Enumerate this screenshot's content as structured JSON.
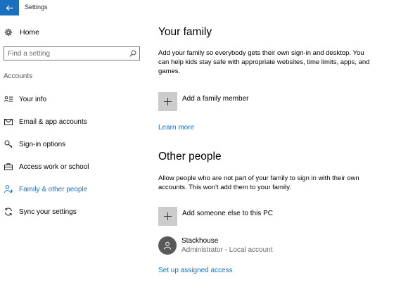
{
  "window": {
    "title": "Settings"
  },
  "sidebar": {
    "home_label": "Home",
    "search_placeholder": "Find a setting",
    "section_label": "Accounts",
    "items": [
      {
        "label": "Your info",
        "icon": "id-card-icon"
      },
      {
        "label": "Email & app accounts",
        "icon": "mail-icon"
      },
      {
        "label": "Sign-in options",
        "icon": "key-icon"
      },
      {
        "label": "Access work or school",
        "icon": "briefcase-icon"
      },
      {
        "label": "Family & other people",
        "icon": "person-add-icon",
        "active": true
      },
      {
        "label": "Sync your settings",
        "icon": "sync-icon"
      }
    ]
  },
  "family": {
    "heading": "Your family",
    "description": "Add your family so everybody gets their own sign-in and desktop. You can help kids stay safe with appropriate websites, time limits, apps, and games.",
    "add_label": "Add a family member",
    "learn_more": "Learn more"
  },
  "others": {
    "heading": "Other people",
    "description": "Allow people who are not part of your family to sign in with their own accounts. This won't add them to your family.",
    "add_label": "Add someone else to this PC",
    "user": {
      "name": "Stackhouse",
      "role": "Administrator - Local account"
    },
    "assigned_access": "Set up assigned access"
  },
  "colors": {
    "accent": "#1b6fbf",
    "tile": "#cccccc",
    "avatar": "#595959"
  }
}
